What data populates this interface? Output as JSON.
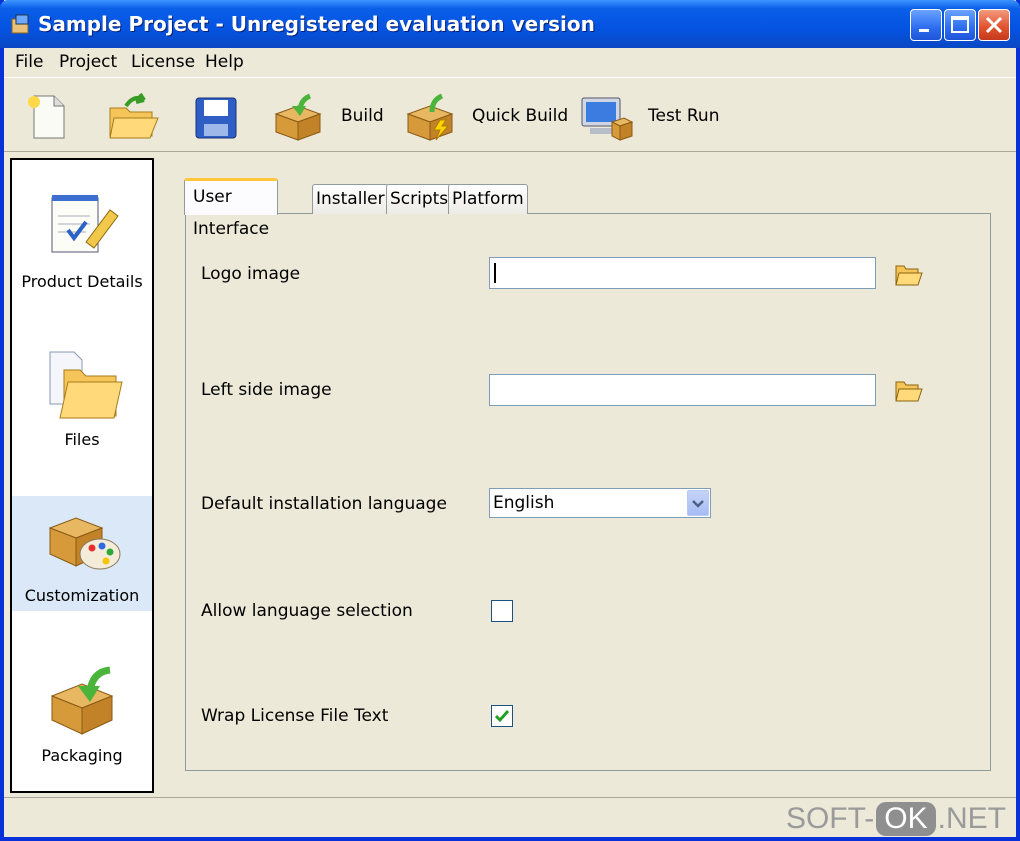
{
  "window": {
    "title": "Sample Project - Unregistered evaluation version",
    "app_icon": "installer-app-icon",
    "controls": [
      "minimize-icon",
      "maximize-icon",
      "close-icon"
    ]
  },
  "menu": {
    "items": [
      {
        "label": "File"
      },
      {
        "label": "Project"
      },
      {
        "label": "License"
      },
      {
        "label": "Help"
      }
    ]
  },
  "toolbar": {
    "new_icon": "new-document-icon",
    "open_icon": "open-folder-icon",
    "save_icon": "save-disk-icon",
    "build_label": "Build",
    "quick_build_label": "Quick Build",
    "test_run_label": "Test Run"
  },
  "sidebar": {
    "items": [
      {
        "label": "Product Details",
        "icon": "notepad-pencil-icon",
        "selected": false
      },
      {
        "label": "Files",
        "icon": "files-folder-icon",
        "selected": false
      },
      {
        "label": "Customization",
        "icon": "box-palette-icon",
        "selected": true
      },
      {
        "label": "Packaging",
        "icon": "box-arrow-icon",
        "selected": false
      }
    ]
  },
  "tabs": [
    {
      "label": "User Interface",
      "active": true
    },
    {
      "label": "Installer",
      "active": false
    },
    {
      "label": "Scripts",
      "active": false
    },
    {
      "label": "Platform",
      "active": false
    }
  ],
  "form": {
    "logo_image": {
      "label": "Logo image",
      "value": ""
    },
    "left_side_image": {
      "label": "Left side image",
      "value": ""
    },
    "default_language": {
      "label": "Default installation language",
      "value": "English"
    },
    "allow_language_selection": {
      "label": "Allow language selection",
      "checked": false
    },
    "wrap_license": {
      "label": "Wrap License File Text",
      "checked": true
    }
  },
  "watermark": {
    "left": "SOFT-",
    "box": "OK",
    "right": ".NET"
  },
  "colors": {
    "titlebar": "#0453e1",
    "window_bg": "#ece9d8",
    "selected_item": "#dbe8f7",
    "tab_highlight": "#ffc83c",
    "check": "#21a121"
  }
}
